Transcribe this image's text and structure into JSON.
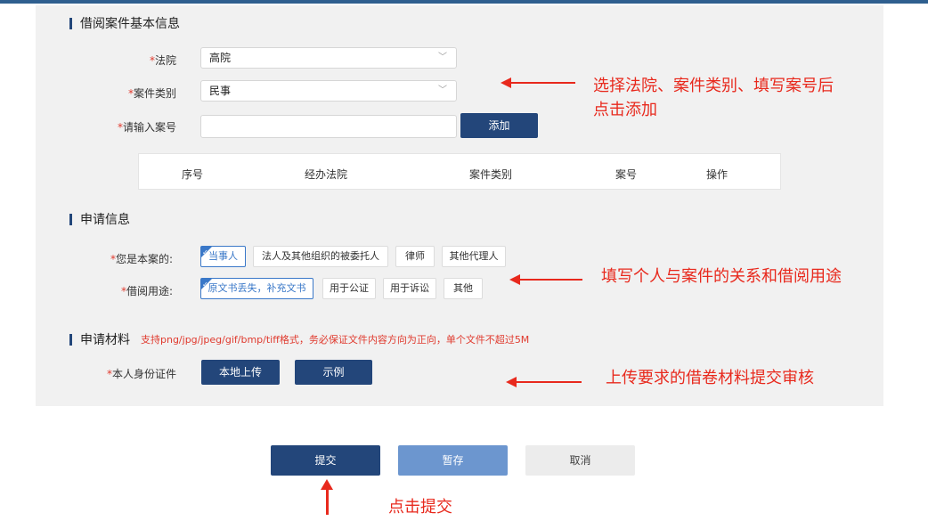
{
  "section_basic": {
    "title": "借阅案件基本信息"
  },
  "court": {
    "label": "法院",
    "value": "高院"
  },
  "case_type": {
    "label": "案件类别",
    "value": "民事"
  },
  "case_number": {
    "label": "请输入案号",
    "value": ""
  },
  "add_button": "添加",
  "table": {
    "headers": [
      "序号",
      "经办法院",
      "案件类别",
      "案号",
      "操作"
    ]
  },
  "section_apply": {
    "title": "申请信息"
  },
  "role": {
    "label": "您是本案的:",
    "options": [
      "当事人",
      "法人及其他组织的被委托人",
      "律师",
      "其他代理人"
    ],
    "selected": "当事人"
  },
  "purpose": {
    "label": "借阅用途:",
    "options": [
      "原文书丢失，补充文书",
      "用于公证",
      "用于诉讼",
      "其他"
    ],
    "selected": "原文书丢失，补充文书"
  },
  "section_material": {
    "title": "申请材料",
    "note": "支持png/jpg/jpeg/gif/bmp/tiff格式，务必保证文件内容方向为正向，单个文件不超过5M"
  },
  "id_doc": {
    "label": "本人身份证件",
    "upload": "本地上传",
    "example": "示例"
  },
  "footer": {
    "submit": "提交",
    "save": "暂存",
    "cancel": "取消"
  },
  "annotations": {
    "a1": "选择法院、案件类别、填写案号后",
    "a1b": "点击添加",
    "a2": "填写个人与案件的关系和借阅用途",
    "a3": "上传要求的借卷材料提交审核",
    "a4": "点击提交"
  },
  "colors": {
    "primary": "#23467a",
    "accent": "#3a78c8",
    "annotation_red": "#e8291d"
  }
}
